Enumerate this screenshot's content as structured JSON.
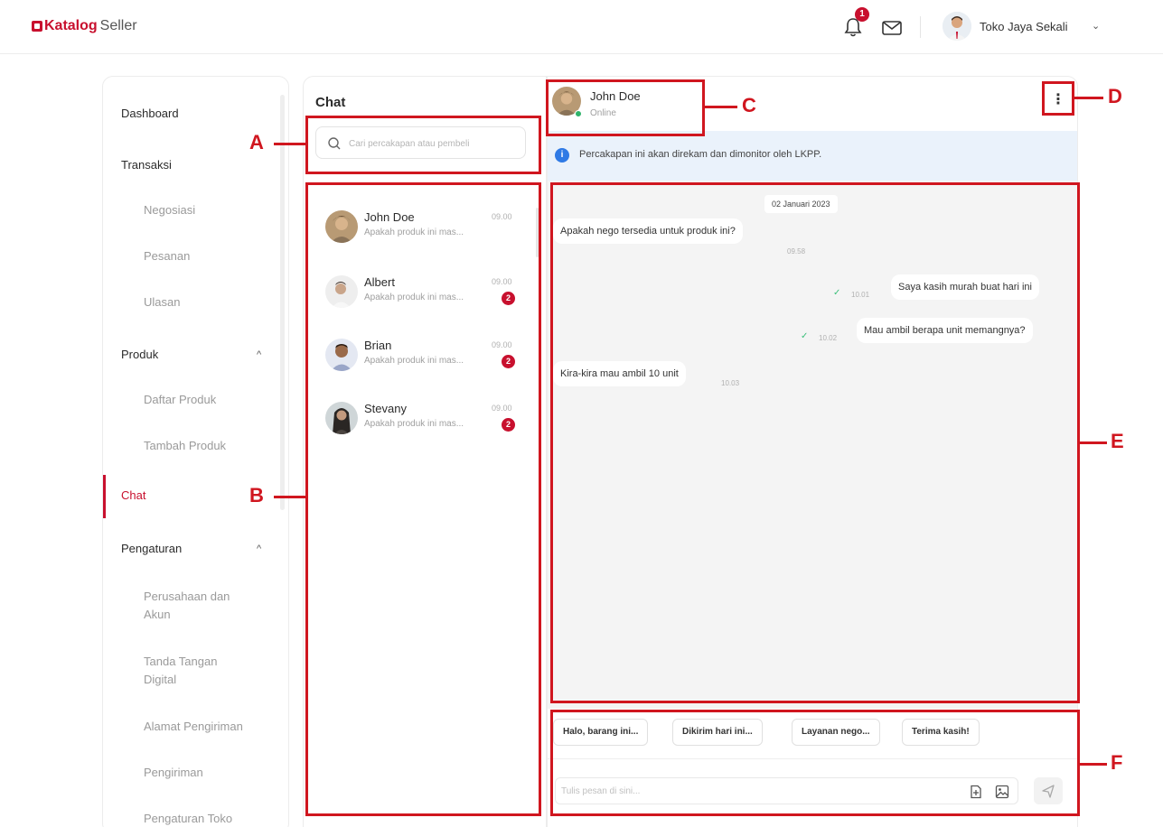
{
  "app": {
    "logo_brand": "Katalog",
    "logo_suffix": "Seller",
    "notification_count": "1",
    "user_name": "Toko Jaya Sekali",
    "user_caret": "⌄"
  },
  "sidebar": {
    "dashboard": "Dashboard",
    "transaksi": "Transaksi",
    "negosiasi": "Negosiasi",
    "pesanan": "Pesanan",
    "ulasan": "Ulasan",
    "produk": "Produk",
    "daftar_produk": "Daftar Produk",
    "tambah_produk": "Tambah Produk",
    "chat": "Chat",
    "pengaturan": "Pengaturan",
    "perusahaan_akun": "Perusahaan dan Akun",
    "tanda_tangan": "Tanda Tangan Digital",
    "alamat_pengiriman": "Alamat Pengiriman",
    "pengiriman": "Pengiriman",
    "pengaturan_toko": "Pengaturan Toko",
    "caret_up": "^"
  },
  "chat_list": {
    "title": "Chat",
    "search_placeholder": "Cari percakapan atau pembeli",
    "conversations": [
      {
        "name": "John Doe",
        "time": "09.00",
        "preview": "Apakah produk ini mas...",
        "unread": ""
      },
      {
        "name": "Albert",
        "time": "09.00",
        "preview": "Apakah produk ini mas...",
        "unread": "2"
      },
      {
        "name": "Brian",
        "time": "09.00",
        "preview": "Apakah produk ini mas...",
        "unread": "2"
      },
      {
        "name": "Stevany",
        "time": "09.00",
        "preview": "Apakah produk ini mas...",
        "unread": "2"
      }
    ]
  },
  "conversation": {
    "contact_name": "John Doe",
    "contact_status": "Online",
    "menu_label": "⋮",
    "notice": "Percakapan ini akan direkam dan dimonitor oleh LKPP.",
    "notice_icon": "i",
    "date": "02 Januari 2023",
    "messages": [
      {
        "text": "Apakah nego tersedia untuk produk ini?",
        "time": "09.58",
        "from": "buyer"
      },
      {
        "text": "Saya kasih murah buat hari ini",
        "time": "10.01",
        "from": "seller"
      },
      {
        "text": "Mau ambil berapa unit memangnya?",
        "time": "10.02",
        "from": "seller"
      },
      {
        "text": "Kira-kira mau ambil 10 unit",
        "time": "10.03",
        "from": "buyer"
      }
    ],
    "quick_replies": [
      "Halo, barang ini...",
      "Dikirim hari ini...",
      "Layanan nego...",
      "Terima kasih!"
    ],
    "input_placeholder": "Tulis pesan di sini..."
  },
  "annotations": {
    "a": "A",
    "b": "B",
    "c": "C",
    "d": "D",
    "e": "E",
    "f": "F"
  },
  "colors": {
    "accent": "#c8102e",
    "annotation": "#d0161f",
    "online": "#2fb36a",
    "notice_bg": "#eaf2fb",
    "messages_bg": "#f4f4f4"
  },
  "icons": [
    "bell-icon",
    "mail-icon",
    "search-icon",
    "info-icon",
    "kebab-menu-icon",
    "check-icon",
    "attach-file-icon",
    "image-icon",
    "send-icon",
    "chevron-up-icon",
    "chevron-down-icon"
  ]
}
